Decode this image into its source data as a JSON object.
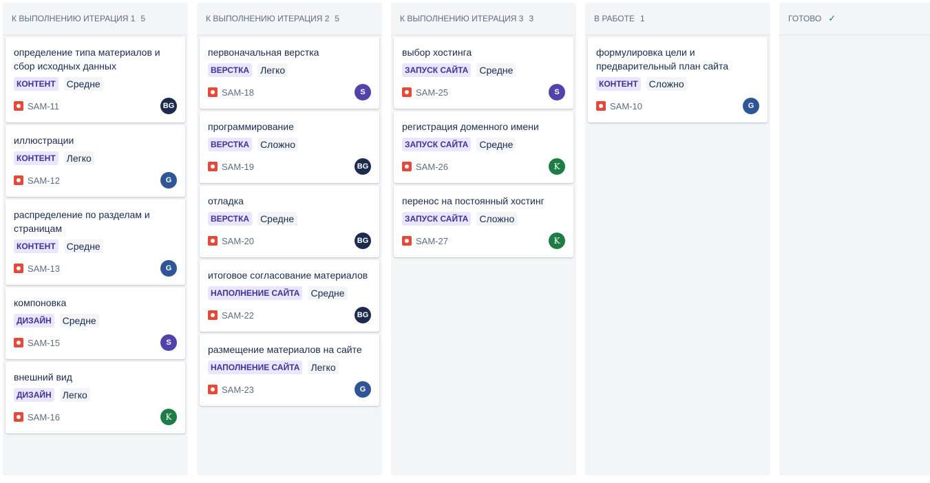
{
  "columns": [
    {
      "title": "К ВЫПОЛНЕНИЮ ИТЕРАЦИЯ 1",
      "count": "5",
      "cards": [
        {
          "title": "определение типа материалов и сбор исходных данных",
          "epic": "КОНТЕНТ",
          "complexity": "Средне",
          "key": "SAM-11",
          "assignee": "BG"
        },
        {
          "title": "иллюстрации",
          "epic": "КОНТЕНТ",
          "complexity": "Легко",
          "key": "SAM-12",
          "assignee": "G"
        },
        {
          "title": "распределение по разделам и страницам",
          "epic": "КОНТЕНТ",
          "complexity": "Средне",
          "key": "SAM-13",
          "assignee": "G"
        },
        {
          "title": "компоновка",
          "epic": "ДИЗАЙН",
          "complexity": "Средне",
          "key": "SAM-15",
          "assignee": "S"
        },
        {
          "title": "внешний вид",
          "epic": "ДИЗАЙН",
          "complexity": "Легко",
          "key": "SAM-16",
          "assignee": "K"
        }
      ]
    },
    {
      "title": "К ВЫПОЛНЕНИЮ ИТЕРАЦИЯ 2",
      "count": "5",
      "cards": [
        {
          "title": "первоначальная верстка",
          "epic": "ВЕРСТКА",
          "complexity": "Легко",
          "key": "SAM-18",
          "assignee": "S"
        },
        {
          "title": "программирование",
          "epic": "ВЕРСТКА",
          "complexity": "Сложно",
          "key": "SAM-19",
          "assignee": "BG"
        },
        {
          "title": "отладка",
          "epic": "ВЕРСТКА",
          "complexity": "Средне",
          "key": "SAM-20",
          "assignee": "BG"
        },
        {
          "title": "итоговое согласование материалов",
          "epic": "НАПОЛНЕНИЕ САЙТА",
          "complexity": "Средне",
          "key": "SAM-22",
          "assignee": "BG"
        },
        {
          "title": "размещение материалов на сайте",
          "epic": "НАПОЛНЕНИЕ САЙТА",
          "complexity": "Легко",
          "key": "SAM-23",
          "assignee": "G"
        }
      ]
    },
    {
      "title": "К ВЫПОЛНЕНИЮ ИТЕРАЦИЯ 3",
      "count": "3",
      "cards": [
        {
          "title": "выбор хостинга",
          "epic": "ЗАПУСК САЙТА",
          "complexity": "Средне",
          "key": "SAM-25",
          "assignee": "S"
        },
        {
          "title": "регистрация доменного имени",
          "epic": "ЗАПУСК САЙТА",
          "complexity": "Средне",
          "key": "SAM-26",
          "assignee": "K"
        },
        {
          "title": "перенос на постоянный хостинг",
          "epic": "ЗАПУСК САЙТА",
          "complexity": "Сложно",
          "key": "SAM-27",
          "assignee": "K"
        }
      ]
    },
    {
      "title": "В РАБОТЕ",
      "count": "1",
      "cards": [
        {
          "title": "формулировка цели и предварительный план сайта",
          "epic": "КОНТЕНТ",
          "complexity": "Сложно",
          "key": "SAM-10",
          "assignee": "G"
        }
      ]
    },
    {
      "title": "ГОТОВО",
      "count": "",
      "done_icon": "checkmark-icon",
      "cards": []
    }
  ],
  "colors": {
    "epic_bg": "#eae6ff",
    "epic_text": "#403294",
    "bug_icon": "#e5493a",
    "done_check": "#00875a"
  }
}
